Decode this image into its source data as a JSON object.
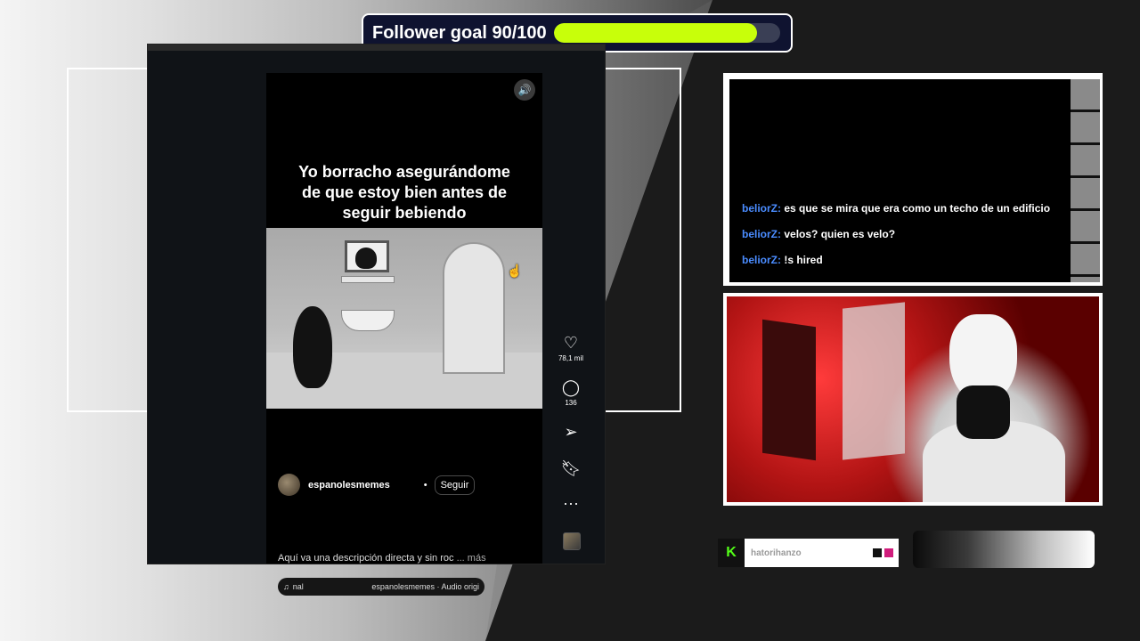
{
  "goal": {
    "label": "Follower goal 90/100",
    "progress": 0.9,
    "fill_color": "#c8ff0a"
  },
  "reel": {
    "caption_lines": [
      "Yo borracho asegurándome",
      "de que estoy bien antes de",
      "seguir bebiendo"
    ],
    "mute_icon": "speaker-icon",
    "author": "espanolesmemes",
    "separator": "•",
    "follow_label": "Seguir",
    "description": "Aquí va una descripción directa y sin roc",
    "more_label": "... más",
    "audio_track": "nal",
    "audio_artist": "espanolesmemes · Audio origi",
    "likes": "78,1 mil",
    "comments": "136"
  },
  "chat": {
    "messages": [
      {
        "user": "beliorZ:",
        "text": "es que se mira que era como un techo de un edificio"
      },
      {
        "user": "beliorZ:",
        "text": "velos? quien es velo?"
      },
      {
        "user": "beliorZ:",
        "text": "!s hired"
      }
    ],
    "user_color": "#4a8cff"
  },
  "userbar": {
    "platform_letter": "K",
    "username": "hatorihanzo",
    "platform_color": "#53fc18",
    "swatch_colors": [
      "#111111",
      "#d01d7c"
    ]
  }
}
